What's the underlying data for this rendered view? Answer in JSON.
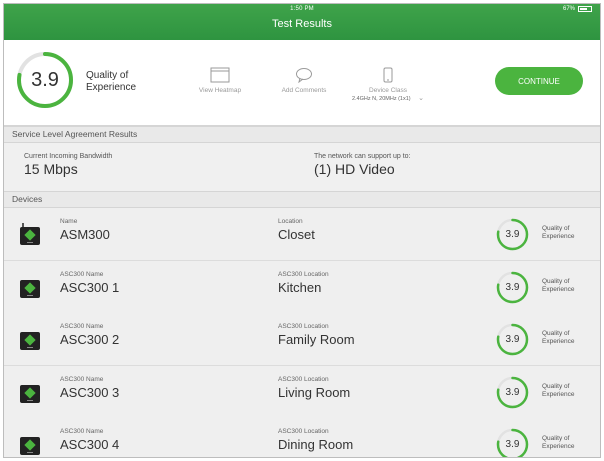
{
  "status": {
    "time": "1:50 PM",
    "battery": "67%"
  },
  "header": {
    "title": "Test Results"
  },
  "summary": {
    "score": "3.9",
    "score_fraction": 0.78,
    "qoe_line1": "Quality of",
    "qoe_line2": "Experience",
    "heatmap_label": "View Heatmap",
    "comments_label": "Add Comments",
    "device_class_label": "Device Class",
    "device_class_value": "2.4GHz N, 20MHz (1x1)",
    "continue_label": "CONTINUE"
  },
  "sla": {
    "title": "Service Level Agreement Results",
    "bandwidth_label": "Current Incoming Bandwidth",
    "bandwidth_value": "15 Mbps",
    "support_label": "The network can support up to:",
    "support_value": "(1) HD Video"
  },
  "devices_title": "Devices",
  "colors": {
    "accent": "#4bb43f",
    "header": "#2e9440"
  },
  "devices": [
    {
      "name_label": "Name",
      "name": "ASM300",
      "loc_label": "Location",
      "location": "Closet",
      "score": "3.9",
      "q1": "Quality of",
      "q2": "Experience",
      "antenna": true
    },
    {
      "name_label": "ASC300 Name",
      "name": "ASC300 1",
      "loc_label": "ASC300 Location",
      "location": "Kitchen",
      "score": "3.9",
      "q1": "Quality of",
      "q2": "Experience",
      "antenna": false
    },
    {
      "name_label": "ASC300 Name",
      "name": "ASC300 2",
      "loc_label": "ASC300 Location",
      "location": "Family Room",
      "score": "3.9",
      "q1": "Quality of",
      "q2": "Experience",
      "antenna": false
    },
    {
      "name_label": "ASC300 Name",
      "name": "ASC300 3",
      "loc_label": "ASC300 Location",
      "location": "Living Room",
      "score": "3.9",
      "q1": "Quality of",
      "q2": "Experience",
      "antenna": false
    },
    {
      "name_label": "ASC300 Name",
      "name": "ASC300 4",
      "loc_label": "ASC300 Location",
      "location": "Dining Room",
      "score": "3.9",
      "q1": "Quality of",
      "q2": "Experience",
      "antenna": false
    }
  ]
}
